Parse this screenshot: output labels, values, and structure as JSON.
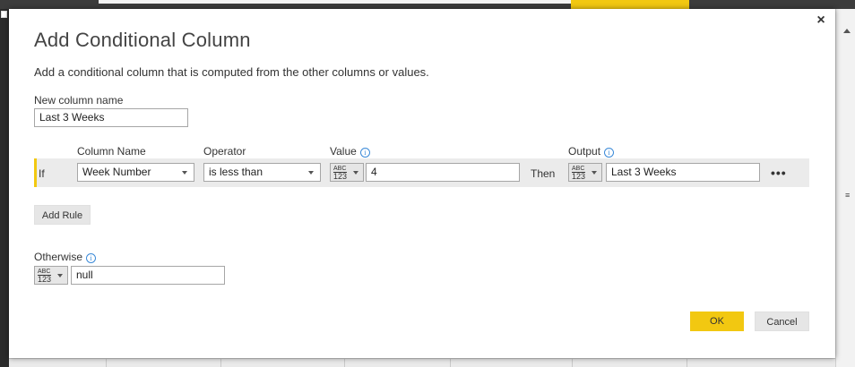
{
  "dialog": {
    "title": "Add Conditional Column",
    "description": "Add a conditional column that is computed from the other columns or values.",
    "close_icon": "×"
  },
  "new_column": {
    "label": "New column name",
    "value": "Last 3 Weeks"
  },
  "rules": {
    "headers": {
      "column_name": "Column Name",
      "operator": "Operator",
      "value": "Value",
      "output": "Output"
    },
    "rows": [
      {
        "if_label": "If",
        "column": "Week Number",
        "operator": "is less than",
        "value_type_top": "ABC",
        "value_type_bottom": "123",
        "value": "4",
        "then_label": "Then",
        "output_type_top": "ABC",
        "output_type_bottom": "123",
        "output": "Last 3 Weeks",
        "more_icon": "•••"
      }
    ],
    "add_rule_label": "Add Rule"
  },
  "otherwise": {
    "label": "Otherwise",
    "type_top": "ABC",
    "type_bottom": "123",
    "value": "null"
  },
  "buttons": {
    "ok": "OK",
    "cancel": "Cancel"
  },
  "colors": {
    "accent": "#f2c811",
    "info": "#3b8ad8"
  }
}
